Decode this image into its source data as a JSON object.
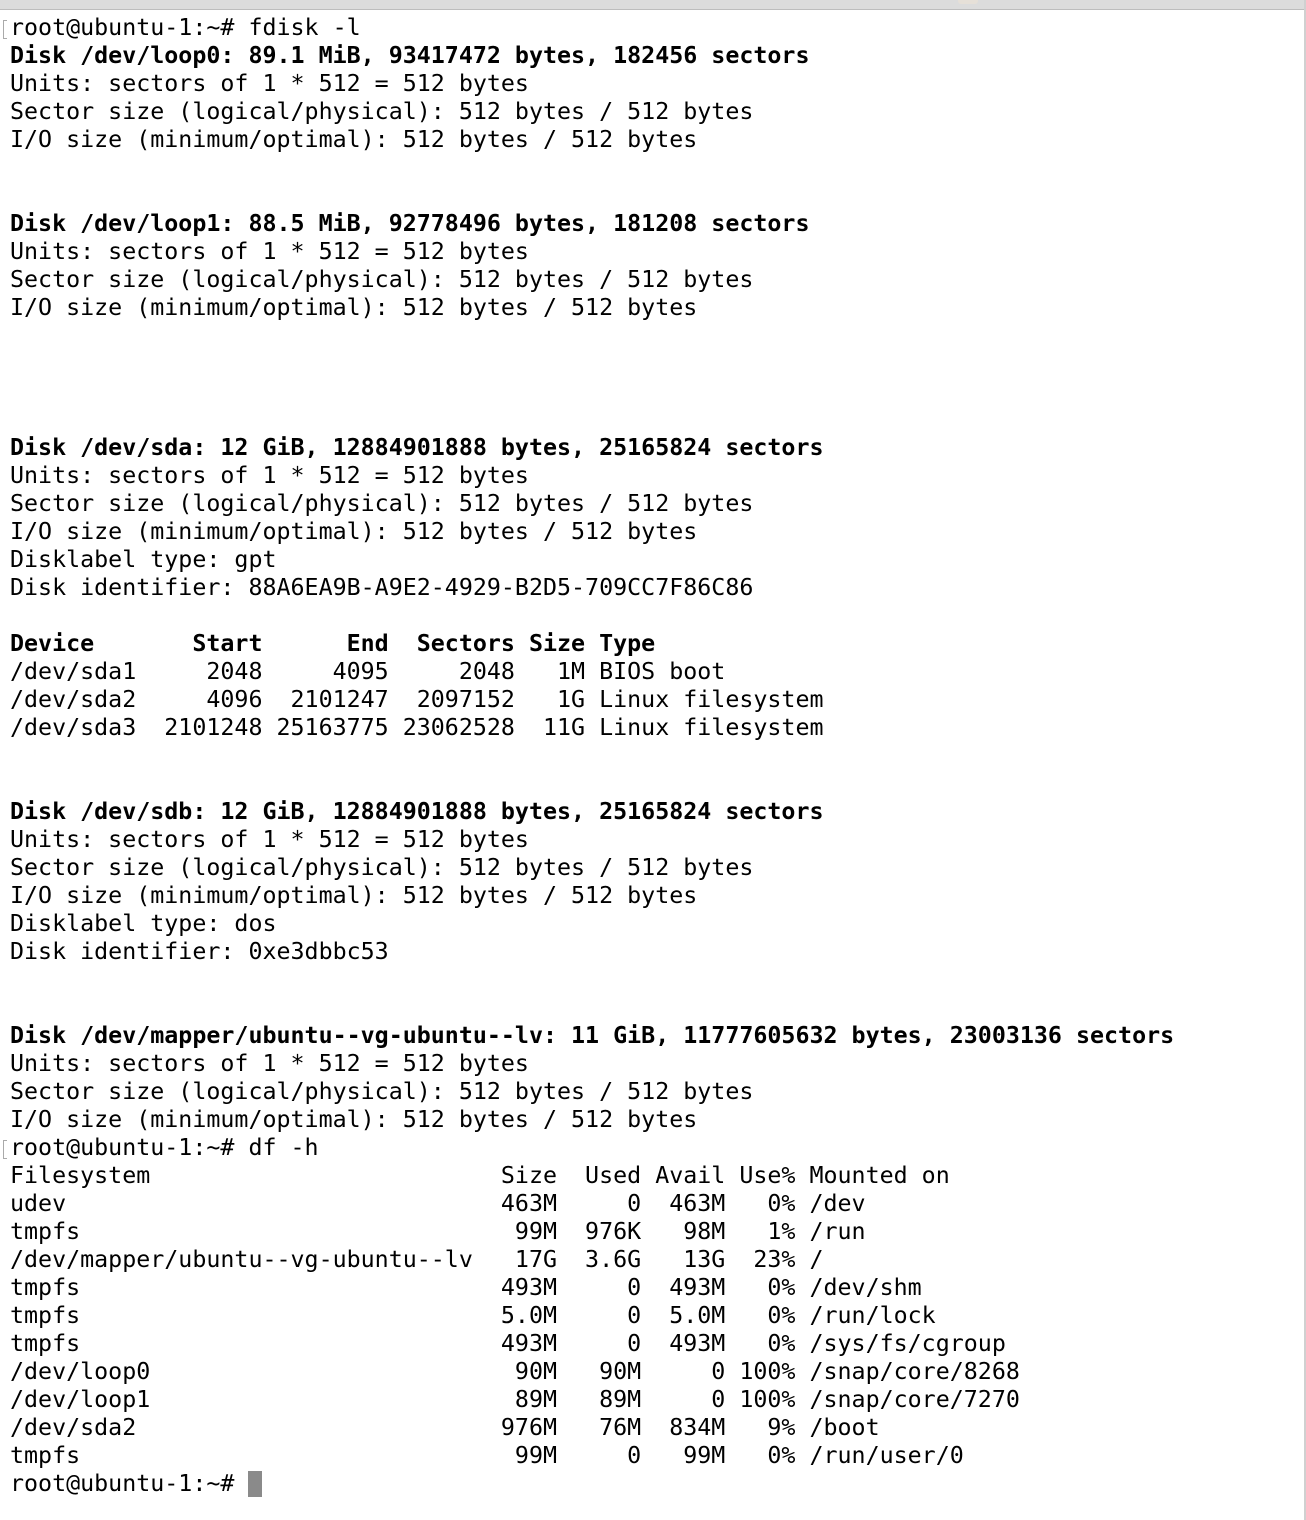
{
  "terminal": {
    "lines": [
      {
        "text": "root@ubuntu-1:~# fdisk -l",
        "bold": false,
        "marker": true
      },
      {
        "text": "Disk /dev/loop0: 89.1 MiB, 93417472 bytes, 182456 sectors",
        "bold": true
      },
      {
        "text": "Units: sectors of 1 * 512 = 512 bytes",
        "bold": false
      },
      {
        "text": "Sector size (logical/physical): 512 bytes / 512 bytes",
        "bold": false
      },
      {
        "text": "I/O size (minimum/optimal): 512 bytes / 512 bytes",
        "bold": false
      },
      {
        "text": "",
        "bold": false
      },
      {
        "text": "",
        "bold": false
      },
      {
        "text": "Disk /dev/loop1: 88.5 MiB, 92778496 bytes, 181208 sectors",
        "bold": true
      },
      {
        "text": "Units: sectors of 1 * 512 = 512 bytes",
        "bold": false
      },
      {
        "text": "Sector size (logical/physical): 512 bytes / 512 bytes",
        "bold": false
      },
      {
        "text": "I/O size (minimum/optimal): 512 bytes / 512 bytes",
        "bold": false
      },
      {
        "text": "",
        "bold": false
      },
      {
        "text": "",
        "bold": false
      },
      {
        "text": "",
        "bold": false
      },
      {
        "text": "",
        "bold": false
      },
      {
        "text": "Disk /dev/sda: 12 GiB, 12884901888 bytes, 25165824 sectors",
        "bold": true
      },
      {
        "text": "Units: sectors of 1 * 512 = 512 bytes",
        "bold": false
      },
      {
        "text": "Sector size (logical/physical): 512 bytes / 512 bytes",
        "bold": false
      },
      {
        "text": "I/O size (minimum/optimal): 512 bytes / 512 bytes",
        "bold": false
      },
      {
        "text": "Disklabel type: gpt",
        "bold": false
      },
      {
        "text": "Disk identifier: 88A6EA9B-A9E2-4929-B2D5-709CC7F86C86",
        "bold": false
      },
      {
        "text": "",
        "bold": false
      },
      {
        "text": "Device       Start      End  Sectors Size Type",
        "bold": true
      },
      {
        "text": "/dev/sda1     2048     4095     2048   1M BIOS boot",
        "bold": false
      },
      {
        "text": "/dev/sda2     4096  2101247  2097152   1G Linux filesystem",
        "bold": false
      },
      {
        "text": "/dev/sda3  2101248 25163775 23062528  11G Linux filesystem",
        "bold": false
      },
      {
        "text": "",
        "bold": false
      },
      {
        "text": "",
        "bold": false
      },
      {
        "text": "Disk /dev/sdb: 12 GiB, 12884901888 bytes, 25165824 sectors",
        "bold": true
      },
      {
        "text": "Units: sectors of 1 * 512 = 512 bytes",
        "bold": false
      },
      {
        "text": "Sector size (logical/physical): 512 bytes / 512 bytes",
        "bold": false
      },
      {
        "text": "I/O size (minimum/optimal): 512 bytes / 512 bytes",
        "bold": false
      },
      {
        "text": "Disklabel type: dos",
        "bold": false
      },
      {
        "text": "Disk identifier: 0xe3dbbc53",
        "bold": false
      },
      {
        "text": "",
        "bold": false
      },
      {
        "text": "",
        "bold": false
      },
      {
        "text": "Disk /dev/mapper/ubuntu--vg-ubuntu--lv: 11 GiB, 11777605632 bytes, 23003136 sectors",
        "bold": true
      },
      {
        "text": "Units: sectors of 1 * 512 = 512 bytes",
        "bold": false
      },
      {
        "text": "Sector size (logical/physical): 512 bytes / 512 bytes",
        "bold": false
      },
      {
        "text": "I/O size (minimum/optimal): 512 bytes / 512 bytes",
        "bold": false
      },
      {
        "text": "root@ubuntu-1:~# df -h",
        "bold": false,
        "marker": true
      },
      {
        "text": "Filesystem                         Size  Used Avail Use% Mounted on",
        "bold": false
      },
      {
        "text": "udev                               463M     0  463M   0% /dev",
        "bold": false
      },
      {
        "text": "tmpfs                               99M  976K   98M   1% /run",
        "bold": false
      },
      {
        "text": "/dev/mapper/ubuntu--vg-ubuntu--lv   17G  3.6G   13G  23% /",
        "bold": false
      },
      {
        "text": "tmpfs                              493M     0  493M   0% /dev/shm",
        "bold": false
      },
      {
        "text": "tmpfs                              5.0M     0  5.0M   0% /run/lock",
        "bold": false
      },
      {
        "text": "tmpfs                              493M     0  493M   0% /sys/fs/cgroup",
        "bold": false
      },
      {
        "text": "/dev/loop0                          90M   90M     0 100% /snap/core/8268",
        "bold": false
      },
      {
        "text": "/dev/loop1                          89M   89M     0 100% /snap/core/7270",
        "bold": false
      },
      {
        "text": "/dev/sda2                          976M   76M  834M   9% /boot",
        "bold": false
      },
      {
        "text": "tmpfs                               99M     0   99M   0% /run/user/0",
        "bold": false
      }
    ],
    "prompt": "root@ubuntu-1:~# "
  }
}
